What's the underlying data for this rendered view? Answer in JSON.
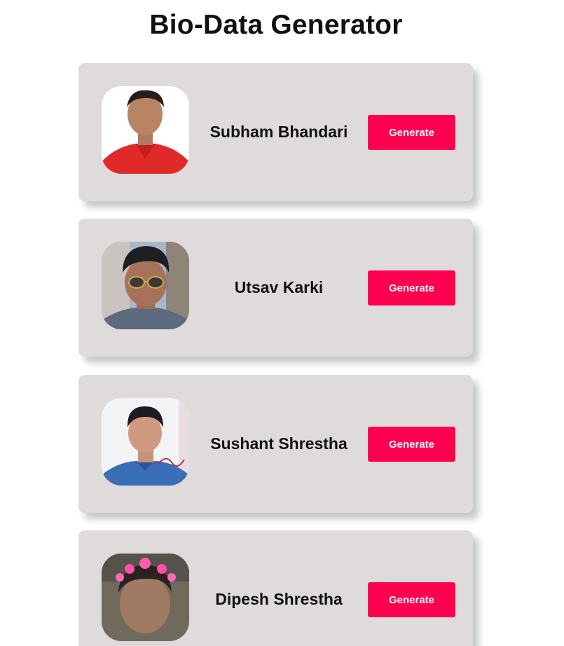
{
  "header": {
    "title": "Bio-Data Generator"
  },
  "profiles": [
    {
      "name": "Subham Bhandari",
      "button_label": "Generate"
    },
    {
      "name": "Utsav Karki",
      "button_label": "Generate"
    },
    {
      "name": "Sushant Shrestha",
      "button_label": "Generate"
    },
    {
      "name": "Dipesh Shrestha",
      "button_label": "Generate"
    }
  ],
  "colors": {
    "card_background": "#e0dbdb",
    "button_background": "#ff0050",
    "button_text": "#ffffff",
    "page_background": "#ffffff"
  }
}
